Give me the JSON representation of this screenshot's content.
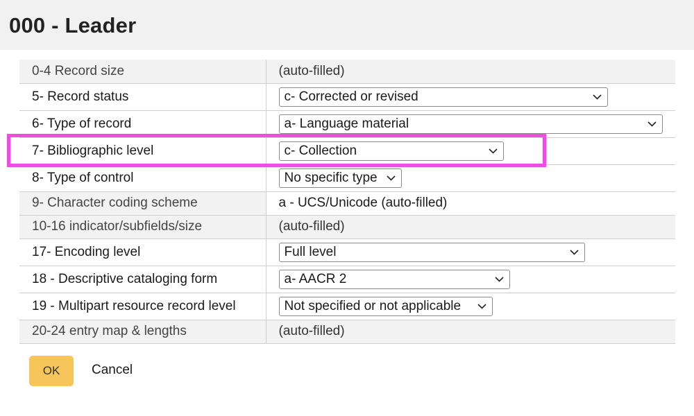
{
  "header": {
    "title": "000 - Leader"
  },
  "rows": [
    {
      "label": "0-4 Record size",
      "value": "(auto-filled)"
    },
    {
      "label": "5- Record status",
      "value": "c- Corrected or revised"
    },
    {
      "label": "6- Type of record",
      "value": "a- Language material"
    },
    {
      "label": "7- Bibliographic level",
      "value": "c- Collection"
    },
    {
      "label": "8- Type of control",
      "value": "No specific type"
    },
    {
      "label": "9- Character coding scheme",
      "value": "a - UCS/Unicode (auto-filled)"
    },
    {
      "label": "10-16 indicator/subfields/size",
      "value": "(auto-filled)"
    },
    {
      "label": "17- Encoding level",
      "value": "Full level"
    },
    {
      "label": "18 - Descriptive cataloging form",
      "value": "a- AACR 2"
    },
    {
      "label": "19 - Multipart resource record level",
      "value": "Not specified or not applicable"
    },
    {
      "label": "20-24 entry map & lengths",
      "value": "(auto-filled)"
    }
  ],
  "actions": {
    "ok_label": "OK",
    "cancel_label": "Cancel"
  },
  "icons": {
    "dropdown": "chevron-down-icon"
  },
  "colors": {
    "highlight": "#ec4fe0",
    "ok_button": "#f7c65a",
    "header_bg": "#f1f1f1",
    "auto_row_bg": "#f2f2f2"
  }
}
